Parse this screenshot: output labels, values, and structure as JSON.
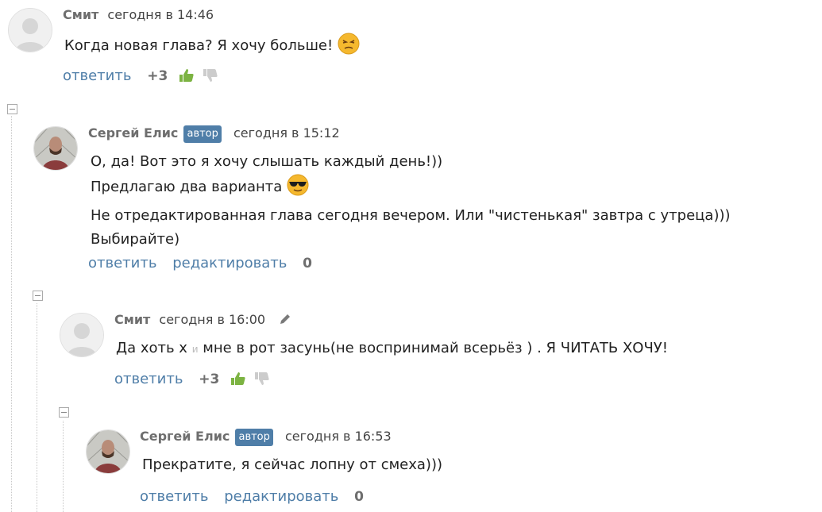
{
  "comments": [
    {
      "author": "Смит",
      "date": "сегодня в 14:46",
      "lines": [
        "Когда новая глава? Я хочу больше!"
      ],
      "emoji": "unamused-face",
      "reply_label": "ответить",
      "score": "+3"
    },
    {
      "author": "Сергей Елис",
      "badge": "автор",
      "date": "сегодня в 15:12",
      "lines": [
        "О, да! Вот это я хочу слышать каждый день!))",
        "Предлагаю два варианта",
        "Не отредактированная глава сегодня вечером. Или \"чистенькая\" завтра с утреца)))",
        "Выбирайте)"
      ],
      "emoji": "sunglasses-face",
      "reply_label": "ответить",
      "edit_label": "редактировать",
      "score": "0"
    },
    {
      "author": "Смит",
      "date": "сегодня в 16:00",
      "text_a": "Да хоть х",
      "text_b": "и",
      "text_c": "мне в рот засунь(не воспринимай всерьёз ) . Я ЧИТАТЬ ХОЧУ!",
      "reply_label": "ответить",
      "score": "+3"
    },
    {
      "author": "Сергей Елис",
      "badge": "автор",
      "date": "сегодня в 16:53",
      "lines": [
        "Прекратите, я сейчас лопну от смеха)))"
      ],
      "reply_label": "ответить",
      "edit_label": "редактировать",
      "score": "0"
    }
  ],
  "colors": {
    "link": "#4f7ea8",
    "badge_bg": "#4f7ea8",
    "thumb_up": "#7cb342",
    "thumb_down": "#cccccc"
  },
  "icons": [
    "default-avatar-icon",
    "author-avatar-icon",
    "thumb-up-icon",
    "thumb-down-icon",
    "collapse-icon",
    "pencil-icon"
  ]
}
